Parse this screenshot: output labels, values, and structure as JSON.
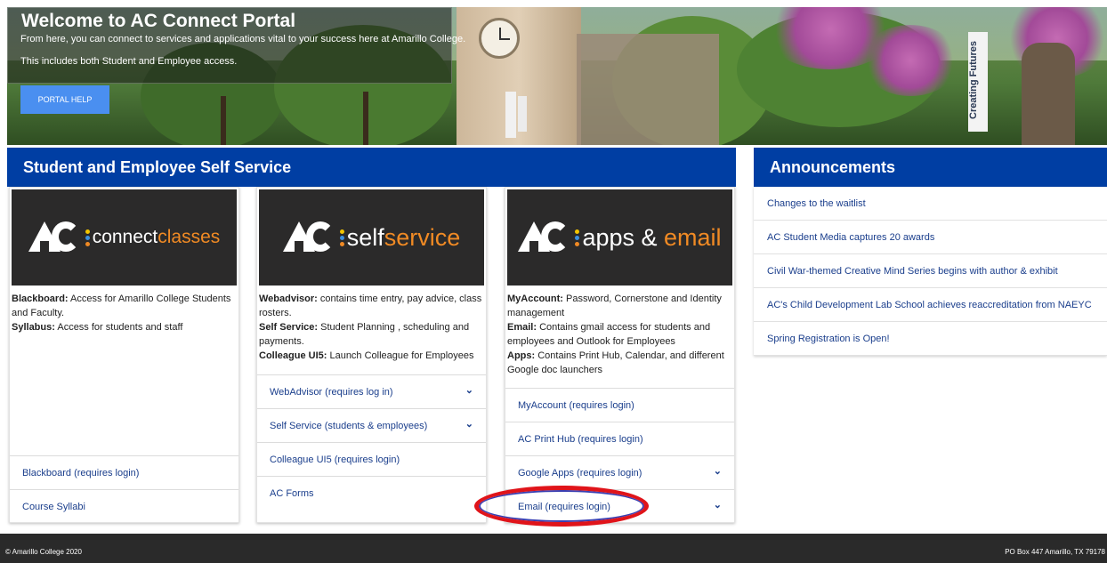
{
  "hero": {
    "title": "Welcome to AC Connect Portal",
    "line1": "From here, you can connect to services and applications vital to your success here at Amarillo College.",
    "line2": "This includes both Student and Employee access.",
    "help_button": "PORTAL HELP",
    "banner_text": "Creating Futures"
  },
  "self_service": {
    "title": "Student and Employee Self Service",
    "cards": [
      {
        "logo": {
          "pre": "connect",
          "highlight": "classes",
          "post": ""
        },
        "desc": [
          {
            "label": "Blackboard:",
            "text": " Access for Amarillo College Students and Faculty."
          },
          {
            "label": "Syllabus:",
            "text": " Access for students and staff"
          }
        ],
        "links": [
          {
            "label": "Blackboard (requires login)"
          },
          {
            "label": "Course Syllabi"
          }
        ]
      },
      {
        "logo": {
          "pre": "self",
          "highlight": "service",
          "post": ""
        },
        "desc": [
          {
            "label": "Webadvisor:",
            "text": " contains time entry, pay advice, class rosters."
          },
          {
            "label": "Self Service:",
            "text": " Student Planning , scheduling and payments."
          },
          {
            "label": "Colleague UI5:",
            "text": " Launch Colleague for Employees"
          }
        ],
        "links": [
          {
            "label": "WebAdvisor (requires log in)"
          },
          {
            "label": "Self Service (students & employees)"
          },
          {
            "label": "Colleague UI5 (requires login)"
          },
          {
            "label": "AC Forms"
          }
        ]
      },
      {
        "logo": {
          "pre": "apps & ",
          "highlight": "email",
          "post": ""
        },
        "desc": [
          {
            "label": "MyAccount:",
            "text": " Password, Cornerstone and Identity management"
          },
          {
            "label": "Email:",
            "text": " Contains gmail access for students and employees and Outlook for Employees"
          },
          {
            "label": "Apps:",
            "text": " Contains Print Hub, Calendar, and different Google doc launchers"
          }
        ],
        "links": [
          {
            "label": "MyAccount (requires login)"
          },
          {
            "label": "AC Print Hub (requires login)"
          },
          {
            "label": "Google Apps (requires login)"
          },
          {
            "label": "Email (requires login)"
          }
        ]
      }
    ]
  },
  "announcements": {
    "title": "Announcements",
    "items": [
      "Changes to the waitlist",
      "AC Student Media captures 20 awards",
      "Civil War-themed Creative Mind Series begins with author & exhibit",
      "AC's Child Development Lab School achieves reaccreditation from NAEYC",
      "Spring Registration is Open!"
    ]
  },
  "footer": {
    "copyright": "© Amarillo College 2020",
    "address": "PO Box 447 Amarillo, TX 79178"
  },
  "colors": {
    "accent_blue": "#003ea3",
    "link_blue": "#1a3e8c",
    "logo_orange": "#f08a24",
    "highlight_red": "#e0141a",
    "dot_yellow": "#f2c500",
    "dot_blue": "#3a8fe0",
    "dot_orange": "#f08a24"
  },
  "icons": {
    "chevron": "chevron-down-icon",
    "ac_logo": "ac-logo-icon"
  }
}
